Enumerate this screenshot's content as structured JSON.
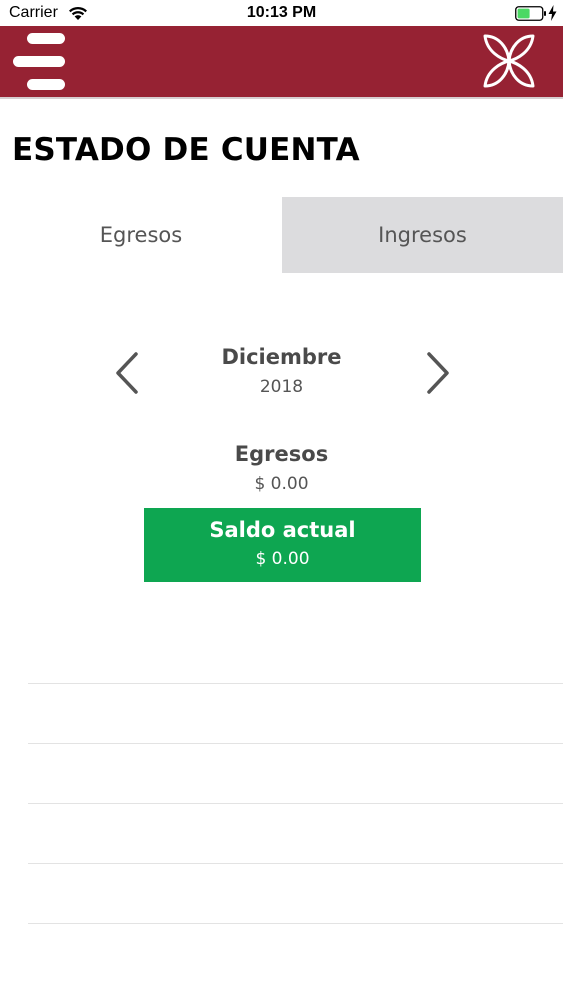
{
  "status_bar": {
    "carrier": "Carrier",
    "time": "10:13 PM",
    "battery_color": "#4cd964"
  },
  "header": {
    "background_color": "#962233",
    "menu_icon": "hamburger-menu-icon",
    "logo_icon": "flower-logo-icon"
  },
  "page": {
    "title": "ESTADO DE CUENTA"
  },
  "tabs": [
    {
      "label": "Egresos",
      "selected": true
    },
    {
      "label": "Ingresos",
      "selected": false
    }
  ],
  "period": {
    "month": "Diciembre",
    "year": "2018",
    "prev_icon": "chevron-left-icon",
    "next_icon": "chevron-right-icon"
  },
  "summary": {
    "label": "Egresos",
    "value": "$ 0.00"
  },
  "balance": {
    "label": "Saldo actual",
    "value": "$ 0.00",
    "color": "#0ea651"
  },
  "list": {
    "rows": [
      "",
      "",
      "",
      "",
      ""
    ]
  }
}
